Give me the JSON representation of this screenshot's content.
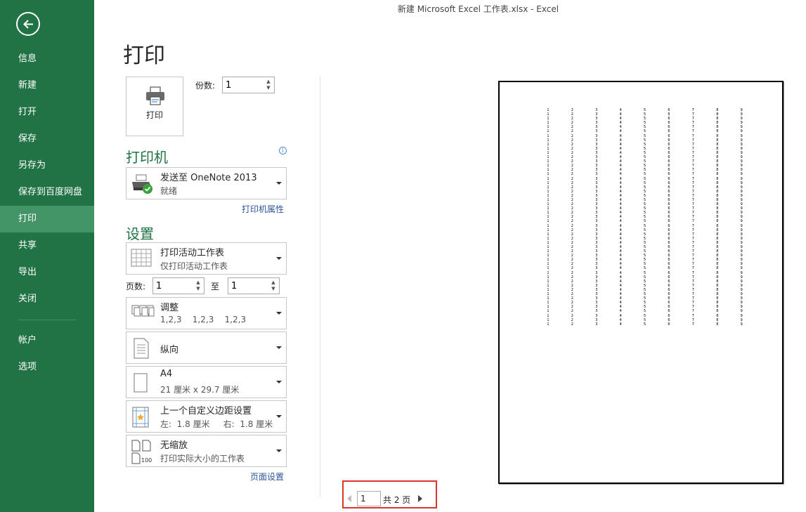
{
  "window": {
    "title": "新建 Microsoft Excel 工作表.xlsx - Excel"
  },
  "sidebar": {
    "items": [
      {
        "label": "信息"
      },
      {
        "label": "新建"
      },
      {
        "label": "打开"
      },
      {
        "label": "保存"
      },
      {
        "label": "另存为"
      },
      {
        "label": "保存到百度网盘"
      },
      {
        "label": "打印"
      },
      {
        "label": "共享"
      },
      {
        "label": "导出"
      },
      {
        "label": "关闭"
      },
      {
        "label": "帐户"
      },
      {
        "label": "选项"
      }
    ],
    "active": "打印"
  },
  "page": {
    "title": "打印"
  },
  "print": {
    "button_label": "打印",
    "copies_label": "份数:",
    "copies_value": "1"
  },
  "printer": {
    "heading": "打印机",
    "name": "发送至 OneNote 2013",
    "status": "就绪",
    "properties_link": "打印机属性"
  },
  "settings": {
    "heading": "设置",
    "sheets": {
      "title": "打印活动工作表",
      "subtitle": "仅打印活动工作表"
    },
    "pages_label": "页数:",
    "pages_from": "1",
    "to_label": "至",
    "pages_to": "1",
    "collate": {
      "title": "调整",
      "subtitle": "1,2,3    1,2,3    1,2,3"
    },
    "orientation": {
      "title": "纵向"
    },
    "paper": {
      "title": "A4",
      "subtitle": "21 厘米 x 29.7 厘米"
    },
    "margins": {
      "title": "上一个自定义边距设置",
      "subtitle": "左:  1.8 厘米     右:  1.8 厘米"
    },
    "scaling": {
      "title": "无缩放",
      "subtitle": "打印实际大小的工作表"
    },
    "page_setup_link": "页面设置"
  },
  "preview": {
    "columns": [
      "1",
      "2",
      "3",
      "4",
      "5",
      "6",
      "7",
      "8",
      "9"
    ],
    "rows": 51
  },
  "pager": {
    "current_page": "1",
    "total_text": "共 2 页"
  },
  "colors": {
    "accent": "#217346",
    "active": "#439467",
    "highlight": "#e0332c"
  }
}
